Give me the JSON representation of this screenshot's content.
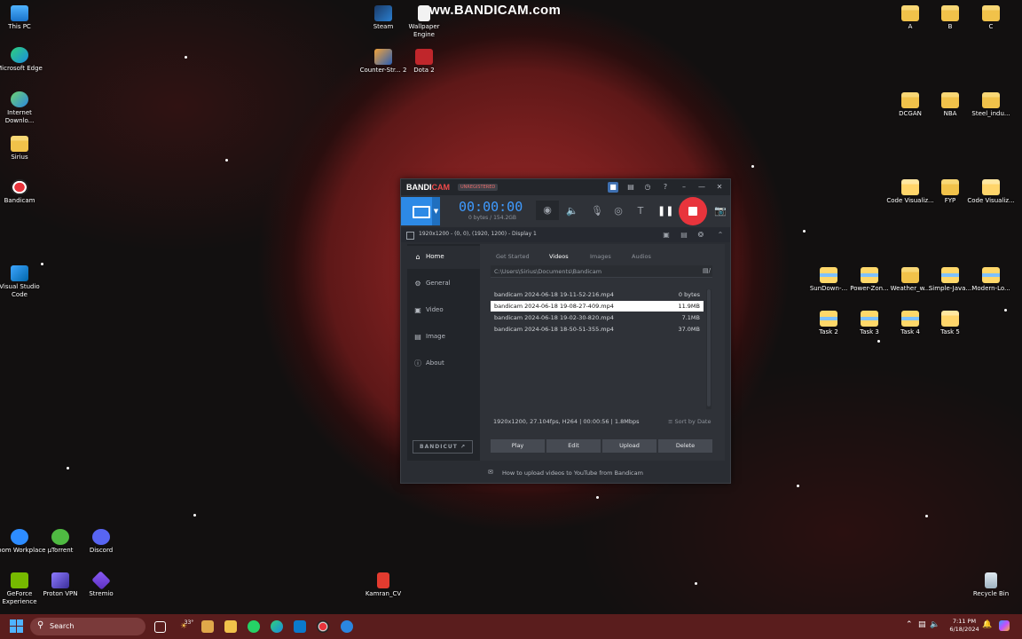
{
  "watermark": "www.BANDICAM.com",
  "desktop_icons": {
    "this_pc": "This PC",
    "edge": "Microsoft Edge",
    "idm": "Internet Downlo...",
    "sirius": "Sirius",
    "bandicam": "Bandicam",
    "vscode": "Visual Studio Code",
    "zoom": "Zoom Workplace",
    "utorrent": "µTorrent",
    "discord": "Discord",
    "geforce": "GeForce Experience",
    "protonvpn": "Proton VPN",
    "stremio": "Stremio",
    "steam": "Steam",
    "wallpaper": "Wallpaper Engine",
    "counterstrike": "Counter-Str... 2",
    "dota": "Dota 2",
    "kamran": "Kamran_CV",
    "a": "A",
    "b": "B",
    "c": "C",
    "dcgan": "DCGAN",
    "nba": "NBA",
    "steel": "Steel_indu...",
    "codevis1": "Code Visualiz...",
    "fyp": "FYP",
    "codevis2": "Code Visualiz...",
    "sundown": "SunDown-...",
    "powerzone": "Power-Zon...",
    "weather": "Weather_w...",
    "simplejava": "Simple-Java...",
    "modernlo": "Modern-Lo...",
    "task2": "Task 2",
    "task3": "Task 3",
    "task4": "Task 4",
    "task5": "Task 5",
    "recycle": "Recycle Bin"
  },
  "bandicam": {
    "logo_band": "BANDI",
    "logo_cam": "CAM",
    "unregistered": "UNREGISTERED",
    "timer": "00:00:00",
    "size": "0 bytes / 154.2GB",
    "display": "1920x1200 - (0, 0), (1920, 1200) - Display 1",
    "nav": [
      "Home",
      "General",
      "Video",
      "Image",
      "About"
    ],
    "bandicut": "BANDICUT ↗",
    "tabs": [
      "Get Started",
      "Videos",
      "Images",
      "Audios"
    ],
    "path": "C:\\Users\\Sirius\\Documents\\Bandicam",
    "files": [
      {
        "name": "bandicam 2024-06-18 19-11-52-216.mp4",
        "size": "0 bytes"
      },
      {
        "name": "bandicam 2024-06-18 19-08-27-409.mp4",
        "size": "11.9MB"
      },
      {
        "name": "bandicam 2024-06-18 19-02-30-820.mp4",
        "size": "7.1MB"
      },
      {
        "name": "bandicam 2024-06-18 18-50-51-355.mp4",
        "size": "37.0MB"
      }
    ],
    "info": "1920x1200, 27.104fps, H264 | 00:00:56 | 1.8Mbps",
    "sort": "Sort by Date",
    "actions": [
      "Play",
      "Edit",
      "Upload",
      "Delete"
    ],
    "help": "How to upload videos to YouTube from Bandicam"
  },
  "taskbar": {
    "search": "Search",
    "time": "7:11 PM",
    "date": "6/18/2024",
    "weather": "33°"
  },
  "colors": {
    "accent": "#2d8ae6",
    "record": "#e8343c",
    "timer": "#3f9bff",
    "taskbar": "#5a1d1d"
  }
}
